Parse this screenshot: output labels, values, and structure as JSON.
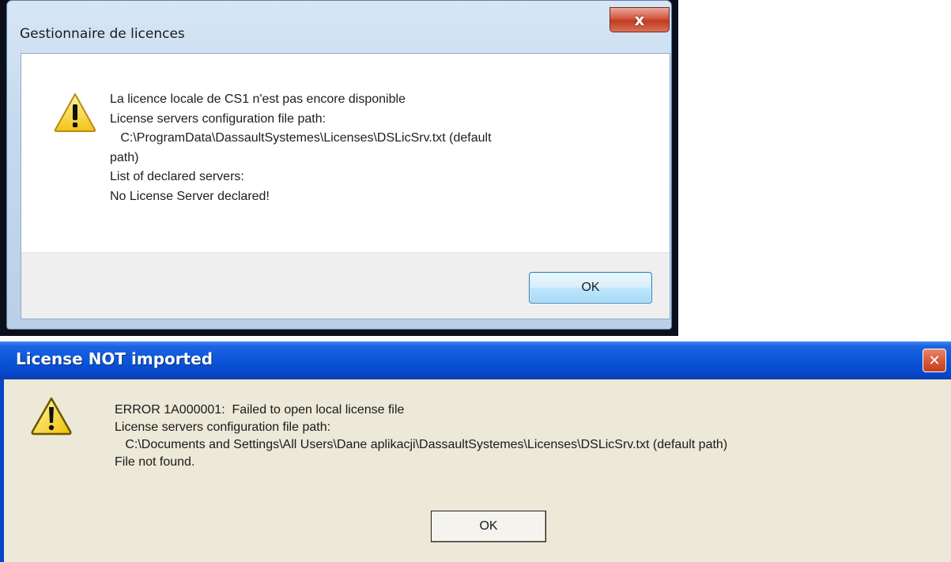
{
  "dialog_win7": {
    "title": "Gestionnaire de licences",
    "close_glyph": "x",
    "icon": "warning-icon",
    "lines": [
      "La licence locale de CS1 n'est pas encore disponible",
      "License servers configuration file path:",
      "   C:\\ProgramData\\DassaultSystemes\\Licenses\\DSLicSrv.txt (default",
      "path)",
      "List of declared servers:",
      "No License Server declared!"
    ],
    "ok_label": "OK"
  },
  "dialog_xp": {
    "title": "License NOT imported",
    "close_glyph": "✕",
    "icon": "warning-icon",
    "lines": [
      "ERROR 1A000001:  Failed to open local license file",
      "License servers configuration file path:",
      "   C:\\Documents and Settings\\All Users\\Dane aplikacji\\DassaultSystemes\\Licenses\\DSLicSrv.txt (default path)",
      "File not found."
    ],
    "ok_label": "OK"
  },
  "colors": {
    "xp_titlebar": "#0a55d8",
    "xp_body": "#ece9d8",
    "win7_frame": "#c4d9ee",
    "warning_yellow": "#f7d21a"
  }
}
